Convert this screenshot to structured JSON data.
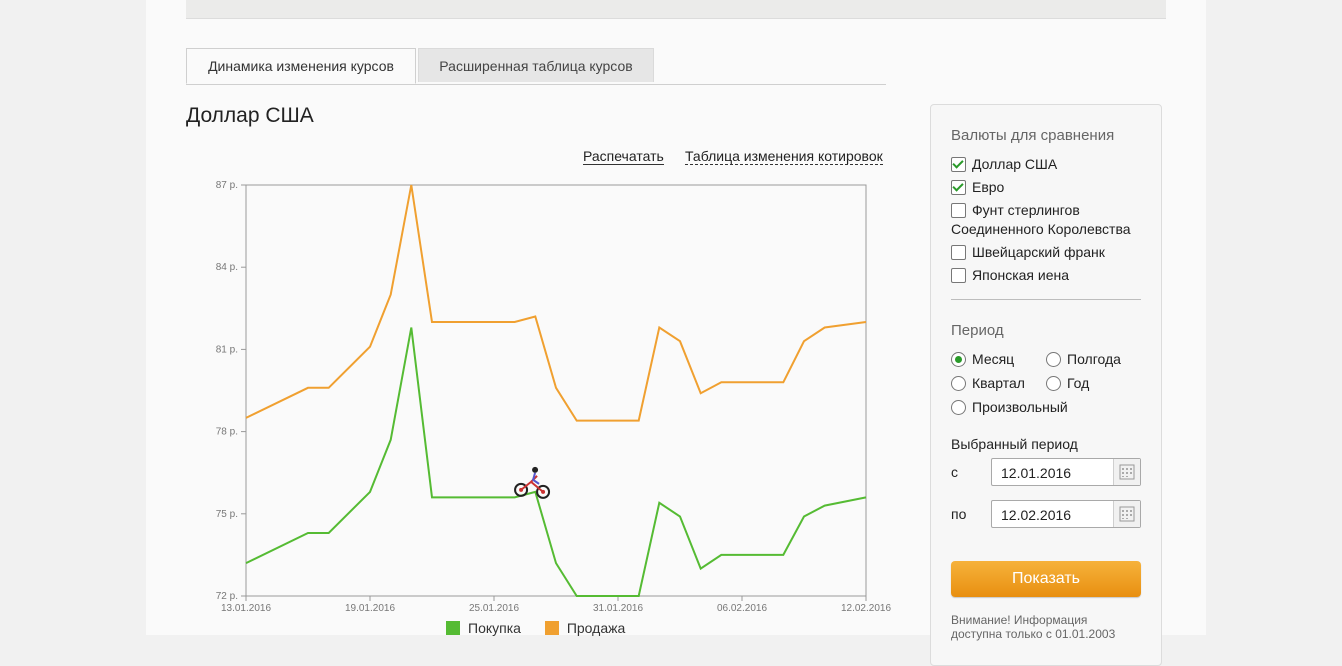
{
  "tabs": [
    {
      "label": "Динамика изменения курсов",
      "active": true
    },
    {
      "label": "Расширенная таблица курсов",
      "active": false
    }
  ],
  "title": "Доллар США",
  "links": {
    "print": "Распечатать",
    "quotes_table": "Таблица изменения котировок"
  },
  "legend": {
    "buy": "Покупка",
    "sell": "Продажа"
  },
  "colors": {
    "buy": "#55bb33",
    "sell": "#f0a030",
    "show_button": "#f0a020"
  },
  "chart_data": {
    "type": "line",
    "title": "",
    "xlabel": "",
    "ylabel": "",
    "ylim": [
      72,
      87
    ],
    "yticks": [
      "87 р.",
      "84 р.",
      "81 р.",
      "78 р.",
      "75 р.",
      "72 р."
    ],
    "xticks": [
      "13.01.2016",
      "19.01.2016",
      "25.01.2016",
      "31.01.2016",
      "06.02.2016",
      "12.02.2016"
    ],
    "x": [
      "13.01",
      "14.01",
      "15.01",
      "16.01",
      "17.01",
      "18.01",
      "19.01",
      "20.01",
      "21.01",
      "22.01",
      "23.01",
      "24.01",
      "25.01",
      "26.01",
      "27.01",
      "28.01",
      "29.01",
      "30.01",
      "31.01",
      "01.02",
      "02.02",
      "03.02",
      "04.02",
      "05.02",
      "06.02",
      "07.02",
      "08.02",
      "09.02",
      "10.02",
      "11.02",
      "12.02"
    ],
    "series": [
      {
        "name": "Продажа",
        "values": [
          78.5,
          null,
          null,
          79.6,
          79.6,
          null,
          81.1,
          83.0,
          87.0,
          82.0,
          null,
          82.0,
          null,
          82.0,
          82.2,
          79.6,
          78.4,
          null,
          78.4,
          78.4,
          81.8,
          81.3,
          79.4,
          79.8,
          null,
          79.8,
          79.8,
          81.3,
          81.8,
          null,
          82.0
        ]
      },
      {
        "name": "Покупка",
        "values": [
          73.2,
          null,
          null,
          74.3,
          74.3,
          null,
          75.8,
          77.7,
          81.8,
          75.6,
          null,
          75.6,
          null,
          75.6,
          75.8,
          73.2,
          72.0,
          null,
          72.0,
          72.0,
          75.4,
          74.9,
          73.0,
          73.5,
          null,
          73.5,
          73.5,
          74.9,
          75.3,
          null,
          75.6
        ]
      }
    ]
  },
  "panel": {
    "currencies_title": "Валюты для сравнения",
    "currencies": [
      {
        "label": "Доллар США",
        "checked": true
      },
      {
        "label": "Евро",
        "checked": true
      },
      {
        "label": "Фунт стерлингов",
        "label2": "Соединенного Королевства",
        "checked": false
      },
      {
        "label": "Швейцарский франк",
        "checked": false
      },
      {
        "label": "Японская иена",
        "checked": false
      }
    ],
    "period_title": "Период",
    "periods": [
      {
        "label": "Месяц",
        "selected": true
      },
      {
        "label": "Полгода",
        "selected": false
      },
      {
        "label": "Квартал",
        "selected": false
      },
      {
        "label": "Год",
        "selected": false
      },
      {
        "label": "Произвольный",
        "selected": false
      }
    ],
    "selected_period_title": "Выбранный период",
    "from_label": "с",
    "to_label": "по",
    "from_value": "12.01.2016",
    "to_value": "12.02.2016",
    "show_button": "Показать",
    "note": "Внимание! Информация доступна только с 01.01.2003"
  }
}
